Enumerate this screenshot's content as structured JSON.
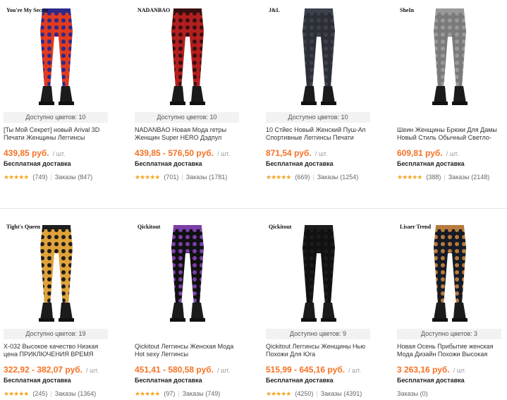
{
  "products": [
    {
      "brand": "You're My Secret",
      "colors": "Доступно цветов: 10",
      "title": "[Ты Мой Секрет] новый Arival 3D Печати Женщины Леггинсы",
      "price": "439,85 руб.",
      "unit": "/ шт.",
      "shipping": "Бесплатная доставка",
      "reviews": "(749)",
      "orders": "Заказы (847)",
      "palette": [
        "#e23b1f",
        "#2b2a8a",
        "#f2a11c"
      ]
    },
    {
      "brand": "NADANBAO",
      "colors": "Доступно цветов: 10",
      "title": "NADANBAO Новая Мода гетры Женщин Super HERO Дэдпул",
      "price": "439,85 - 576,50 руб.",
      "unit": "/ шт.",
      "shipping": "Бесплатная доставка",
      "reviews": "(701)",
      "orders": "Заказы (1781)",
      "palette": [
        "#b31f1f",
        "#3a0f0f",
        "#222222"
      ]
    },
    {
      "brand": "J&L",
      "colors": "Доступно цветов: 10",
      "title": "10 Стйес Новый Женский Пуш-Ап Спортивные Леггинсы Печати",
      "price": "871,54 руб.",
      "unit": "/ шт.",
      "shipping": "Бесплатная доставка",
      "reviews": "(669)",
      "orders": "Заказы (1254)",
      "palette": [
        "#2c2f36",
        "#3d414b",
        "#1a1a1a"
      ]
    },
    {
      "brand": "SheIn",
      "colors": "",
      "title": "Шеин Женщины Брюки Для Дамы Новый Стиль Обычный Светло-",
      "price": "609,81 руб.",
      "unit": "/ шт.",
      "shipping": "Бесплатная доставка",
      "reviews": "(388)",
      "orders": "Заказы (2148)",
      "palette": [
        "#7a7a7a",
        "#999999",
        "#eeeeee"
      ]
    },
    {
      "brand": "Tight's Queen",
      "colors": "Доступно цветов: 19",
      "title": "X-032 Высокое качество Низкая цена ПРИКЛЮЧЕНИЯ ВРЕМЯ",
      "price": "322,92 - 382,07 руб.",
      "unit": "/ шт.",
      "shipping": "Бесплатная доставка",
      "reviews": "(245)",
      "orders": "Заказы (1364)",
      "palette": [
        "#e0a23a",
        "#1e1e1e",
        "#c9c9c9"
      ]
    },
    {
      "brand": "Qickitout",
      "colors": "",
      "title": "Qickitout Леггинсы Женская Мода Hot sexy Леггинсы",
      "price": "451,41 - 580,58 руб.",
      "unit": "/ шт.",
      "shipping": "Бесплатная доставка",
      "reviews": "(97)",
      "orders": "Заказы (749)",
      "palette": [
        "#111111",
        "#7b3fa8",
        "#2bb3c9"
      ]
    },
    {
      "brand": "Qickitout",
      "colors": "Доступно цветов: 9",
      "title": "Qickitout Леггинсы Женщины Нью Похожи Для Юга",
      "price": "515,99 - 645,16 руб.",
      "unit": "/ шт.",
      "shipping": "Бесплатная доставка",
      "reviews": "(4250)",
      "orders": "Заказы (4391)",
      "palette": [
        "#111111",
        "#1c1c1c",
        "#eeeeee"
      ]
    },
    {
      "brand": "Lisaer Trend",
      "colors": "Доступно цветов: 3",
      "title": "Новая Осень Прибытие женская Мода Дизайн Похожи Высокая",
      "price": "3 263,16 руб.",
      "unit": "/ шт.",
      "shipping": "Бесплатная доставка",
      "reviews": "",
      "orders": "Заказы (0)",
      "palette": [
        "#161b26",
        "#b77b3d",
        "#f0d23a"
      ]
    }
  ],
  "stars_glyph": "★★★★★"
}
